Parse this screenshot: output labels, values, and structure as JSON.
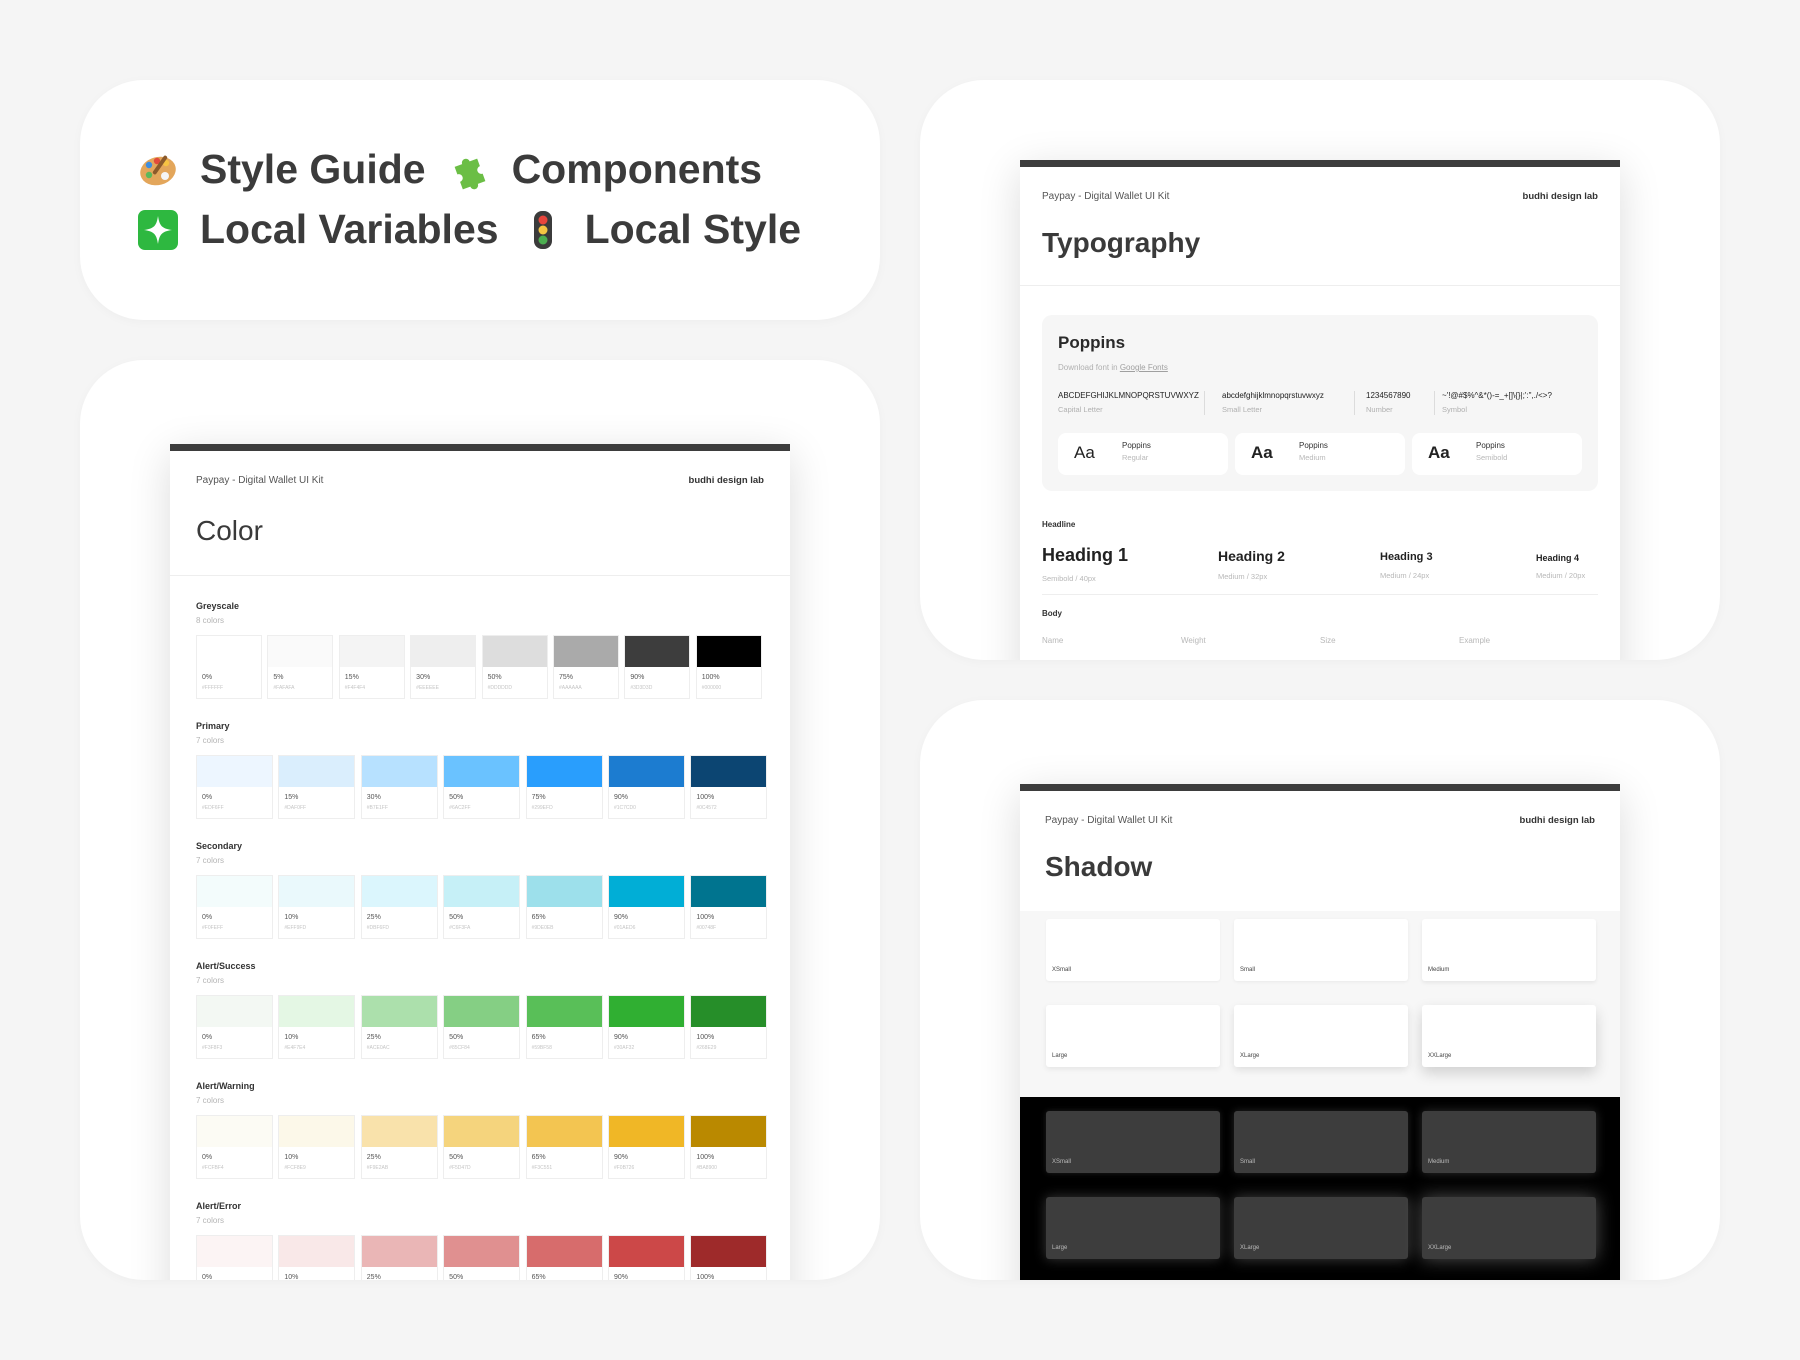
{
  "hero": {
    "row1": [
      {
        "icon": "palette-icon",
        "label": "Style Guide"
      },
      {
        "icon": "puzzle-piece-icon",
        "label": "Components"
      }
    ],
    "row2": [
      {
        "icon": "sparkle-icon",
        "label": "Local Variables"
      },
      {
        "icon": "traffic-light-icon",
        "label": "Local Style"
      }
    ]
  },
  "color_doc": {
    "kit": "Paypay - Digital Wallet UI Kit",
    "brand": "budhi design lab",
    "title": "Color",
    "groups": [
      {
        "name": "Greyscale",
        "count": "8 colors",
        "swatches": [
          {
            "pct": "0%",
            "hex": "#FFFFFF",
            "color": "#FFFFFF"
          },
          {
            "pct": "5%",
            "hex": "#FAFAFA",
            "color": "#FAFAFA"
          },
          {
            "pct": "15%",
            "hex": "#F4F4F4",
            "color": "#F4F4F4"
          },
          {
            "pct": "30%",
            "hex": "#EEEEEE",
            "color": "#EEEEEE"
          },
          {
            "pct": "50%",
            "hex": "#DDDDDD",
            "color": "#DDDDDD"
          },
          {
            "pct": "75%",
            "hex": "#AAAAAA",
            "color": "#AAAAAA"
          },
          {
            "pct": "90%",
            "hex": "#3D3D3D",
            "color": "#3D3D3D"
          },
          {
            "pct": "100%",
            "hex": "#000000",
            "color": "#000000"
          }
        ]
      },
      {
        "name": "Primary",
        "count": "7 colors",
        "swatches": [
          {
            "pct": "0%",
            "hex": "#EDF6FF",
            "color": "#EDF6FF"
          },
          {
            "pct": "15%",
            "hex": "#DAF0FF",
            "color": "#DAEEFD"
          },
          {
            "pct": "30%",
            "hex": "#B7E1FF",
            "color": "#B7E1FF"
          },
          {
            "pct": "50%",
            "hex": "#6AC2FF",
            "color": "#6AC2FF"
          },
          {
            "pct": "75%",
            "hex": "#299EFD",
            "color": "#299EFD"
          },
          {
            "pct": "90%",
            "hex": "#1C7CD0",
            "color": "#1C7CD0"
          },
          {
            "pct": "100%",
            "hex": "#0C4572",
            "color": "#0C4572"
          }
        ]
      },
      {
        "name": "Secondary",
        "count": "7 colors",
        "swatches": [
          {
            "pct": "0%",
            "hex": "#F0FEFF",
            "color": "#F3FCFC"
          },
          {
            "pct": "10%",
            "hex": "#EFF9FD",
            "color": "#EAF9FC"
          },
          {
            "pct": "25%",
            "hex": "#DBF6FD",
            "color": "#DBF6FD"
          },
          {
            "pct": "50%",
            "hex": "#C6F3FA",
            "color": "#C6F0F7"
          },
          {
            "pct": "65%",
            "hex": "#9DE0EB",
            "color": "#9DE0EB"
          },
          {
            "pct": "90%",
            "hex": "#01AED6",
            "color": "#01AED6"
          },
          {
            "pct": "100%",
            "hex": "#00748F",
            "color": "#00748F"
          }
        ]
      },
      {
        "name": "Alert/Success",
        "count": "7 colors",
        "swatches": [
          {
            "pct": "0%",
            "hex": "#F3F8F3",
            "color": "#F3F8F3"
          },
          {
            "pct": "10%",
            "hex": "#E4F7E4",
            "color": "#E4F7E4"
          },
          {
            "pct": "25%",
            "hex": "#ACE0AC",
            "color": "#ACE0AC"
          },
          {
            "pct": "50%",
            "hex": "#85CF84",
            "color": "#85CF84"
          },
          {
            "pct": "65%",
            "hex": "#59BF58",
            "color": "#59BF58"
          },
          {
            "pct": "90%",
            "hex": "#30AF32",
            "color": "#30AF32"
          },
          {
            "pct": "100%",
            "hex": "#268E29",
            "color": "#268E29"
          }
        ]
      },
      {
        "name": "Alert/Warning",
        "count": "7 colors",
        "swatches": [
          {
            "pct": "0%",
            "hex": "#FCFBF4",
            "color": "#FCFBF4"
          },
          {
            "pct": "10%",
            "hex": "#FCF8E9",
            "color": "#FCF8E9"
          },
          {
            "pct": "25%",
            "hex": "#F9E2AB",
            "color": "#F9E2AB"
          },
          {
            "pct": "50%",
            "hex": "#F5D47D",
            "color": "#F5D47D"
          },
          {
            "pct": "65%",
            "hex": "#F3C551",
            "color": "#F3C551"
          },
          {
            "pct": "90%",
            "hex": "#F0B726",
            "color": "#F0B726"
          },
          {
            "pct": "100%",
            "hex": "#BA8900",
            "color": "#BA8900"
          }
        ]
      },
      {
        "name": "Alert/Error",
        "count": "7 colors",
        "swatches": [
          {
            "pct": "0%",
            "hex": "",
            "color": "#FCF4F4"
          },
          {
            "pct": "10%",
            "hex": "",
            "color": "#F9E8E8"
          },
          {
            "pct": "25%",
            "hex": "",
            "color": "#EAB6B6"
          },
          {
            "pct": "50%",
            "hex": "",
            "color": "#E09090"
          },
          {
            "pct": "65%",
            "hex": "",
            "color": "#D76C6C"
          },
          {
            "pct": "90%",
            "hex": "",
            "color": "#CC4848"
          },
          {
            "pct": "100%",
            "hex": "",
            "color": "#9E2A2A"
          }
        ]
      }
    ]
  },
  "typo_doc": {
    "kit": "Paypay - Digital Wallet UI Kit",
    "brand": "budhi design lab",
    "title": "Typography",
    "font_name": "Poppins",
    "download_prefix": "Download font in ",
    "download_link": "Google Fonts",
    "charsets": [
      {
        "value": "ABCDEFGHIJKLMNOPQRSTUVWXYZ",
        "label": "Capital Letter"
      },
      {
        "value": "abcdefghijklmnopqrstuvwxyz",
        "label": "Small Letter"
      },
      {
        "value": "1234567890",
        "label": "Number"
      },
      {
        "value": "~'!@#$%^&*()-=_+[]\\{}|;':\",./<>?",
        "label": "Symbol"
      }
    ],
    "weights": [
      {
        "aa": "Aa",
        "name": "Poppins",
        "weight": "Regular"
      },
      {
        "aa": "Aa",
        "name": "Poppins",
        "weight": "Medium"
      },
      {
        "aa": "Aa",
        "name": "Poppins",
        "weight": "Semibold"
      }
    ],
    "headline_label": "Headline",
    "headings": [
      {
        "text": "Heading 1",
        "meta": "Semibold / 40px"
      },
      {
        "text": "Heading 2",
        "meta": "Medium / 32px"
      },
      {
        "text": "Heading 3",
        "meta": "Medium / 24px"
      },
      {
        "text": "Heading 4",
        "meta": "Medium / 20px"
      }
    ],
    "body_label": "Body",
    "body_columns": [
      "Name",
      "Weight",
      "Size",
      "Example"
    ]
  },
  "shadow_doc": {
    "kit": "Paypay - Digital Wallet UI Kit",
    "brand": "budhi design lab",
    "title": "Shadow",
    "light_boxes": [
      "XSmall",
      "Small",
      "Medium",
      "Large",
      "XLarge",
      "XXLarge"
    ],
    "dark_boxes": [
      "XSmall",
      "Small",
      "Medium",
      "Large",
      "XLarge",
      "XXLarge"
    ]
  }
}
